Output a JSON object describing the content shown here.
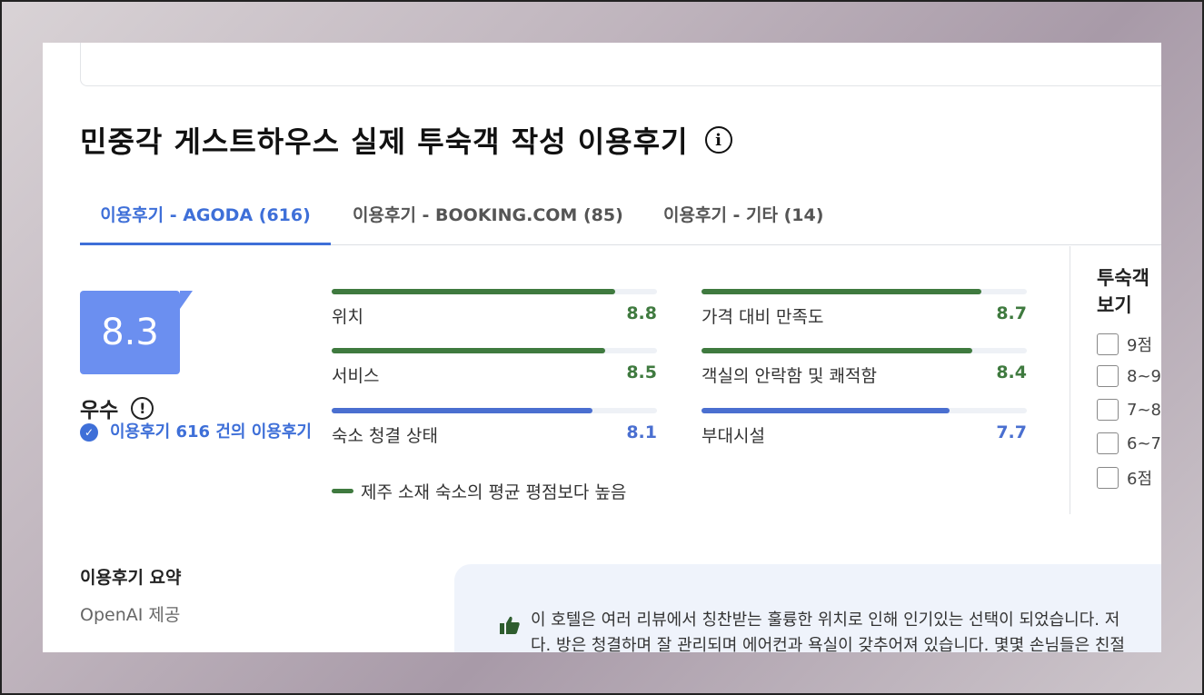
{
  "page": {
    "title": "민중각 게스트하우스 실제 투숙객 작성 이용후기",
    "top_stub": "(+)"
  },
  "tabs": [
    {
      "label": "이용후기 - AGODA (616)",
      "active": true
    },
    {
      "label": "이용후기 - BOOKING.COM (85)",
      "active": false
    },
    {
      "label": "이용후기 - 기타 (14)",
      "active": false
    }
  ],
  "score": {
    "value": "8.3",
    "word": "우수",
    "verified_text": "이용후기 616 건의 이용후기"
  },
  "metrics": [
    {
      "label": "위치",
      "value": "8.8",
      "fill": 0.88,
      "color": "#3f7a3f"
    },
    {
      "label": "가격 대비 만족도",
      "value": "8.7",
      "fill": 0.87,
      "color": "#3f7a3f"
    },
    {
      "label": "서비스",
      "value": "8.5",
      "fill": 0.85,
      "color": "#3f7a3f"
    },
    {
      "label": "객실의 안락함 및 쾌적함",
      "value": "8.4",
      "fill": 0.84,
      "color": "#3f7a3f"
    },
    {
      "label": "숙소 청결 상태",
      "value": "8.1",
      "fill": 0.81,
      "color": "#4a6fd0"
    },
    {
      "label": "부대시설",
      "value": "7.7",
      "fill": 0.77,
      "color": "#4a6fd0"
    }
  ],
  "legend": {
    "label": "제주 소재 숙소의 평균 평점보다 높음",
    "color": "#3f7a3f"
  },
  "filter": {
    "title": "투숙객 보기",
    "options": [
      "9점",
      "8~9",
      "7~8",
      "6~7",
      "6점"
    ]
  },
  "summary": {
    "title": "이용후기 요약",
    "provider": "OpenAI 제공",
    "line1": "이 호텔은 여러 리뷰에서 칭찬받는 훌륭한 위치로 인해 인기있는 선택이 되었습니다. 저",
    "line2": "다. 방은 청결하며 잘 관리되며 에어컨과 욕실이 갖추어져 있습니다. 몇몇 손님들은 친절"
  },
  "colors": {
    "accent": "#3e6fd8",
    "score_bg": "#6b8ff0",
    "above_avg": "#3f7a3f",
    "normal": "#4a6fd0"
  }
}
